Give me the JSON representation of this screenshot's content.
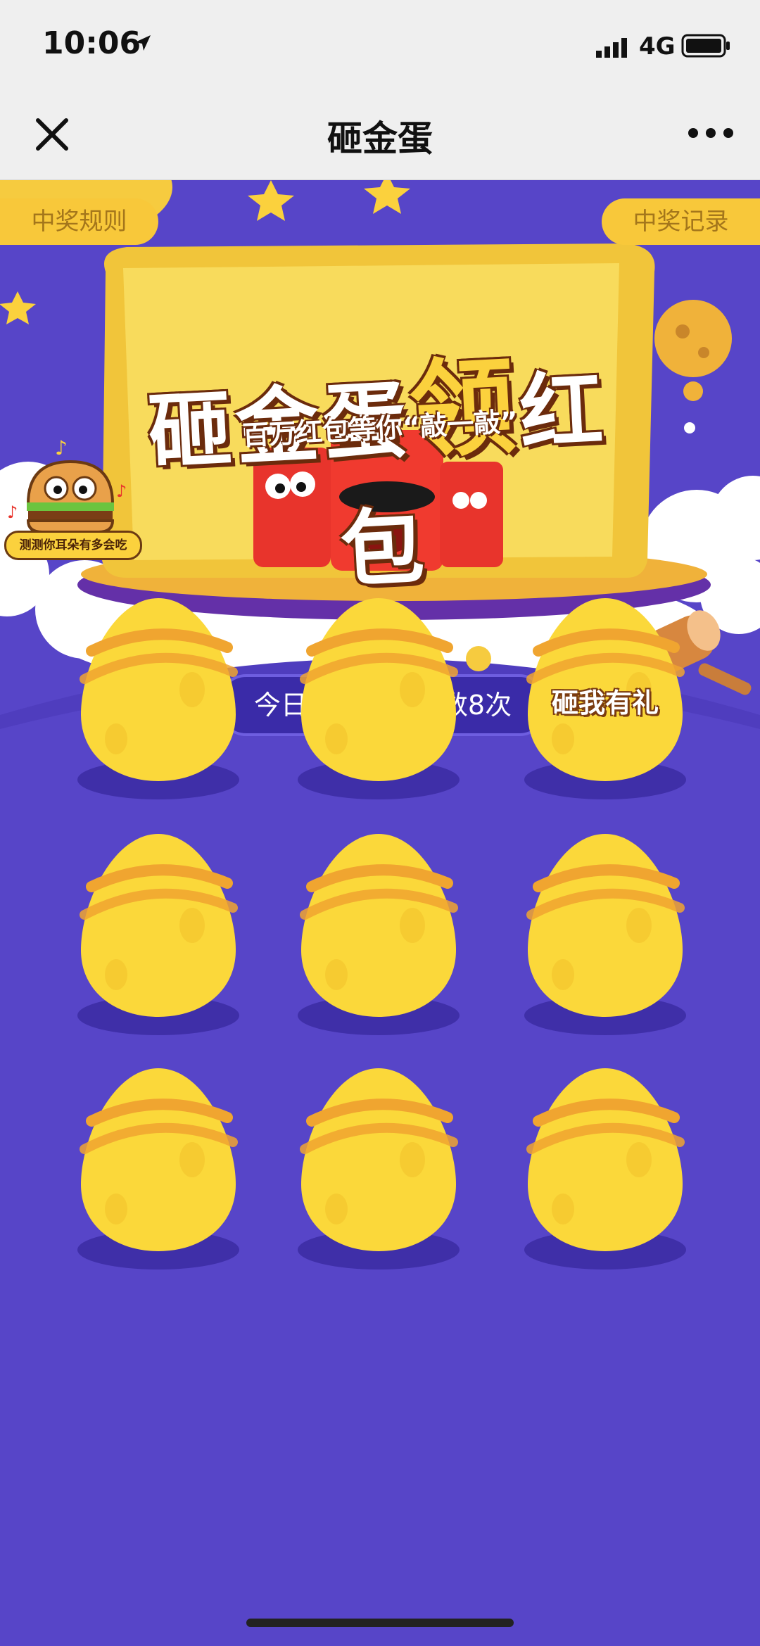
{
  "status_bar": {
    "time": "10:06",
    "network": "4G",
    "icons": [
      "location-arrow-icon",
      "signal-icon",
      "battery-icon"
    ]
  },
  "nav": {
    "title": "砸金蛋",
    "icons": [
      "close-icon",
      "more-icon"
    ]
  },
  "buttons": {
    "rules": "中奖规则",
    "records": "中奖记录"
  },
  "banner": {
    "title_part1": "砸金蛋",
    "title_big": "领",
    "title_part2": "红包",
    "subtitle": "百万红包等你“敲一敲”"
  },
  "burger_widget": {
    "caption": "测测你耳朵有多会吃"
  },
  "free_count": {
    "text": "今日剩余免费次数8次"
  },
  "eggs": {
    "highlight_label": "砸我有礼",
    "count": 9
  },
  "colors": {
    "background": "#5745c8",
    "egg": "#fbd83a",
    "egg_stripe": "#f0a530",
    "pill": "#f8c83a",
    "cloud": "#ffffff"
  }
}
